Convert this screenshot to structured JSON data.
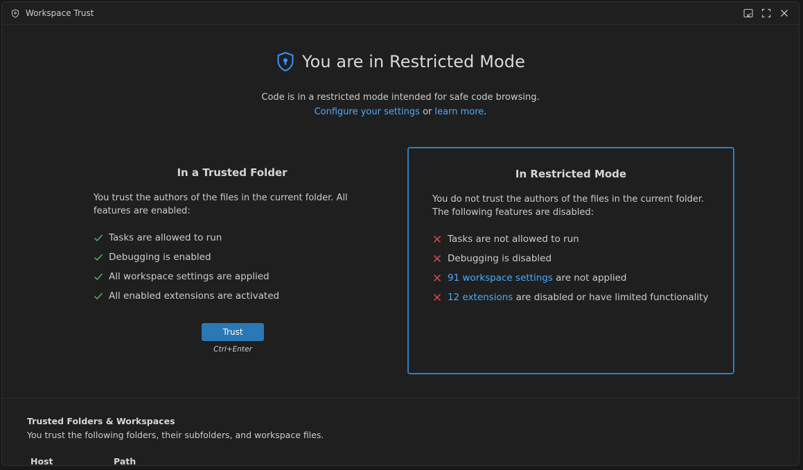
{
  "window": {
    "title": "Workspace Trust"
  },
  "header": {
    "title": "You are in Restricted Mode",
    "subtitle": "Code is in a restricted mode intended for safe code browsing.",
    "configure_link": "Configure your settings",
    "or_text": " or ",
    "learn_link": "learn more",
    "period": "."
  },
  "trusted_panel": {
    "title": "In a Trusted Folder",
    "description": "You trust the authors of the files in the current folder. All features are enabled:",
    "items": [
      "Tasks are allowed to run",
      "Debugging is enabled",
      "All workspace settings are applied",
      "All enabled extensions are activated"
    ],
    "button_label": "Trust",
    "shortcut": "Ctrl+Enter"
  },
  "restricted_panel": {
    "title": "In Restricted Mode",
    "description": "You do not trust the authors of the files in the current folder. The following features are disabled:",
    "items": [
      {
        "text": "Tasks are not allowed to run"
      },
      {
        "text": "Debugging is disabled"
      },
      {
        "link": "91 workspace settings",
        "text": " are not applied"
      },
      {
        "link": "12 extensions",
        "text": " are disabled or have limited functionality"
      }
    ]
  },
  "trusted_folders": {
    "title": "Trusted Folders & Workspaces",
    "description": "You trust the following folders, their subfolders, and workspace files.",
    "columns": [
      "Host",
      "Path"
    ]
  },
  "colors": {
    "accent": "#2f7fc0",
    "link": "#4daafc",
    "check": "#4ec26b",
    "cross": "#f14c4c",
    "button": "#2a78b5"
  }
}
